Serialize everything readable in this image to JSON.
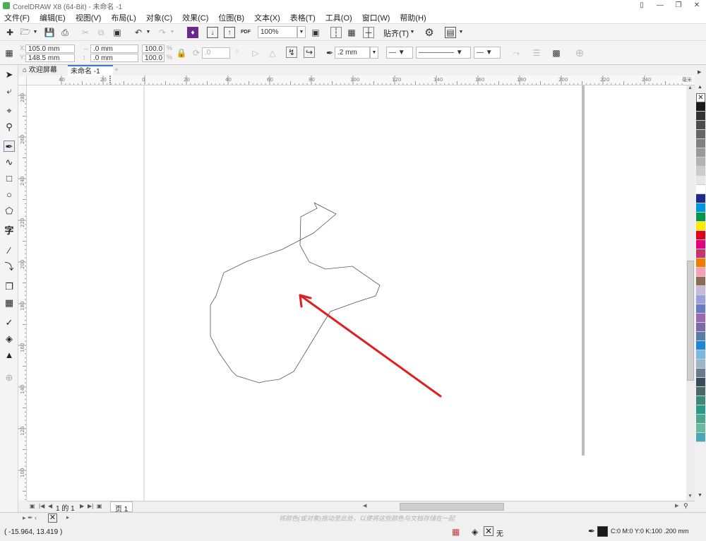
{
  "window": {
    "title": "CorelDRAW X8 (64-Bit) - 未命名 -1"
  },
  "menu": [
    "文件(F)",
    "编辑(E)",
    "视图(V)",
    "布局(L)",
    "对象(C)",
    "效果(C)",
    "位图(B)",
    "文本(X)",
    "表格(T)",
    "工具(O)",
    "窗口(W)",
    "帮助(H)"
  ],
  "toolbar": {
    "pdf_label": "PDF",
    "zoom_value": "100%",
    "snap_label": "贴齐(T)"
  },
  "property_bar": {
    "x_value": "105.0 mm",
    "y_value": "148.5 mm",
    "width_value": ".0 mm",
    "height_value": ".0 mm",
    "scale_x": "100.0",
    "scale_y": "100.0",
    "percent": "%",
    "rotation": ".0",
    "outline_width": ".2 mm"
  },
  "tabs": {
    "welcome": "欢迎屏幕",
    "document": "未命名 -1",
    "add": "+"
  },
  "ruler": {
    "h_labels": [
      "40",
      "20",
      "0",
      "20",
      "40",
      "60",
      "80",
      "100",
      "120",
      "140",
      "160",
      "180",
      "200",
      "220",
      "240"
    ],
    "h_unit": "毫米",
    "v_labels": [
      "280",
      "260",
      "240",
      "220",
      "200",
      "180",
      "160",
      "140",
      "120",
      "100"
    ]
  },
  "page_nav": {
    "counter": "1 的 1",
    "page_tab": "页 1"
  },
  "status": {
    "coordinates": "( -15.964, 13.419 )",
    "hint": "将颜色(或对象)拖动至此处，以便将这些颜色与文档存储在一起",
    "fill_none": "无",
    "outline_info": "C:0 M:0 Y:0 K:100  .200 mm"
  },
  "colors": {
    "arrow": "#e02020",
    "palette": [
      "#ffffff",
      "#1a1a1a",
      "#333333",
      "#4d4d4d",
      "#666666",
      "#808080",
      "#999999",
      "#b3b3b3",
      "#cccccc",
      "#e6e6e6",
      "#ffffff",
      "#1d2a8c",
      "#0096dc",
      "#00964b",
      "#ffeb00",
      "#e30016",
      "#e5007e",
      "#c8346a",
      "#ee7d00",
      "#f5a0b4",
      "#8b6a5a",
      "#c9b9d9",
      "#9aa0d8",
      "#6a7ac4",
      "#9a6ab0",
      "#7b6aa8",
      "#5a7aa8",
      "#1c88d4",
      "#7ab8e0",
      "#9ab8c8",
      "#6a7a8a",
      "#3a4a5a",
      "#4a6a6a",
      "#3a8a7a",
      "#2a9a8a",
      "#4aa890",
      "#6ab8a0",
      "#48a8b8"
    ]
  }
}
